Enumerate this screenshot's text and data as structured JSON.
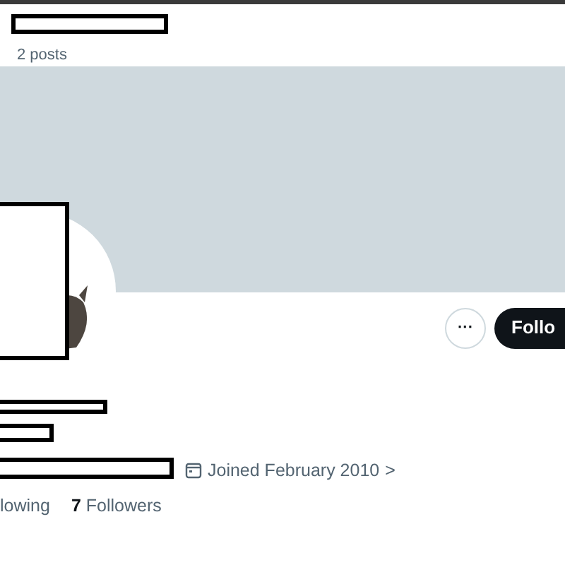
{
  "header": {
    "post_count": "2 posts"
  },
  "actions": {
    "more": "···",
    "follow": "Follo"
  },
  "profile": {
    "joined": "Joined February 2010",
    "joined_arrow": ">"
  },
  "stats": [
    {
      "label": "lowing"
    },
    {
      "count": "7",
      "label": "Followers"
    }
  ]
}
